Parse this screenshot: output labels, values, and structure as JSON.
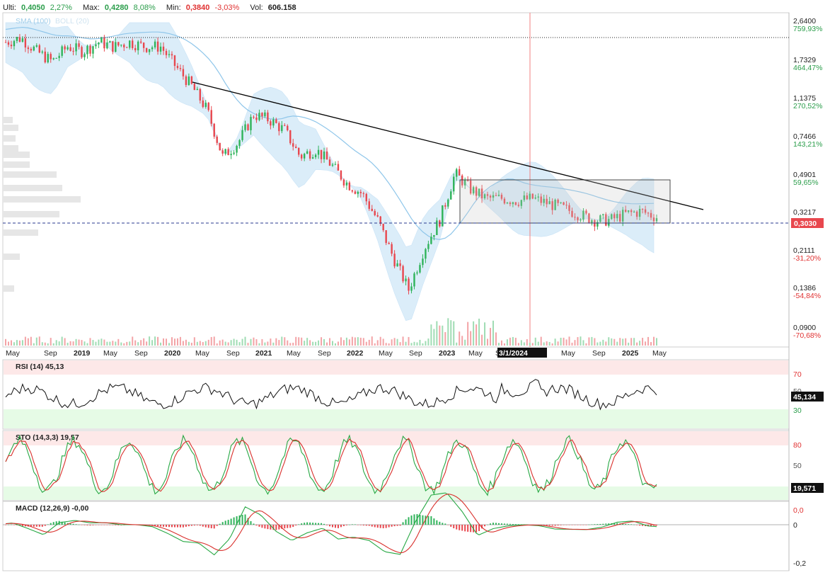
{
  "header": {
    "ulti_label": "Ulti:",
    "ulti_value": "0,4050",
    "ulti_change": "2,27%",
    "max_label": "Max:",
    "max_value": "0,4280",
    "max_change": "8,08%",
    "min_label": "Min:",
    "min_value": "0,3840",
    "min_change": "-3,03%",
    "vol_label": "Vol:",
    "vol_value": "606.158"
  },
  "overlay_legend": {
    "sma": "SMA (100)",
    "boll": "BOLL (20)"
  },
  "price_axis": [
    {
      "price": "2,6400",
      "pct": "759,93%",
      "dir": "up"
    },
    {
      "price": "1,7329",
      "pct": "464,47%",
      "dir": "up"
    },
    {
      "price": "1,1375",
      "pct": "270,52%",
      "dir": "up"
    },
    {
      "price": "0,7466",
      "pct": "143,21%",
      "dir": "up"
    },
    {
      "price": "0,4901",
      "pct": "59,65%",
      "dir": "up"
    },
    {
      "price": "0,3217",
      "pct": "",
      "dir": "up"
    },
    {
      "price": "0,2111",
      "pct": "-31,20%",
      "dir": "dn"
    },
    {
      "price": "0,1386",
      "pct": "-54,84%",
      "dir": "dn"
    },
    {
      "price": "0,0900",
      "pct": "-70,68%",
      "dir": "dn"
    }
  ],
  "current_price_tag": "0,3030",
  "x_axis_labels": [
    "May",
    "Sep",
    "2019",
    "May",
    "Sep",
    "2020",
    "May",
    "Sep",
    "2021",
    "May",
    "Sep",
    "2022",
    "May",
    "Sep",
    "2023",
    "May",
    "Se",
    "3/1/2024",
    "May",
    "Sep",
    "2025",
    "May"
  ],
  "rsi": {
    "title": "RSI (14)",
    "value": "45,13",
    "tag": "45,134",
    "levels": [
      "70",
      "50",
      "30"
    ]
  },
  "sto": {
    "title": "STO (14,3,3)",
    "value": "19,57",
    "tag": "19,571",
    "levels": [
      "80",
      "50"
    ]
  },
  "macd": {
    "title": "MACD (12,26,9)",
    "value": "-0,00",
    "levels": [
      "0,0",
      "0",
      "-0,2"
    ]
  },
  "colors": {
    "up": "#2fb35a",
    "down": "#e8474e",
    "band": "#cfe7f8",
    "sma": "#8fc6ea",
    "trend": "#000000",
    "dashed": "#2a3a8f",
    "rsi_upper_zone": "#fde8e8",
    "rsi_lower_zone": "#e6fbe6"
  },
  "chart_data": {
    "type": "candlestick",
    "title": "",
    "y_scale": "log",
    "ylim": [
      0.09,
      2.64
    ],
    "x": [
      "2018-05",
      "2018-07",
      "2018-09",
      "2018-11",
      "2019-01",
      "2019-03",
      "2019-05",
      "2019-07",
      "2019-09",
      "2019-11",
      "2020-01",
      "2020-03",
      "2020-05",
      "2020-07",
      "2020-09",
      "2020-11",
      "2021-01",
      "2021-03",
      "2021-05",
      "2021-07",
      "2021-09",
      "2021-11",
      "2022-01",
      "2022-03",
      "2022-05",
      "2022-07",
      "2022-09",
      "2022-11",
      "2023-01",
      "2023-03",
      "2023-05",
      "2023-07",
      "2023-09",
      "2023-11",
      "2024-01",
      "2024-03",
      "2024-05",
      "2024-07",
      "2024-09",
      "2024-11",
      "2025-01",
      "2025-03",
      "2025-05"
    ],
    "series": [
      {
        "name": "Close",
        "values": [
          2.1,
          2.2,
          1.9,
          1.7,
          2.0,
          1.9,
          2.1,
          2.0,
          2.1,
          2.0,
          2.0,
          1.6,
          1.3,
          1.0,
          0.6,
          0.7,
          0.95,
          0.9,
          0.8,
          0.6,
          0.65,
          0.55,
          0.45,
          0.4,
          0.3,
          0.2,
          0.14,
          0.22,
          0.3,
          0.5,
          0.42,
          0.38,
          0.38,
          0.37,
          0.38,
          0.36,
          0.34,
          0.32,
          0.3,
          0.3,
          0.32,
          0.33,
          0.31
        ]
      }
    ],
    "annotations": [
      "trend line",
      "range box",
      "dashed line at 0,3030",
      "vertical marker 3/1/2024"
    ]
  }
}
